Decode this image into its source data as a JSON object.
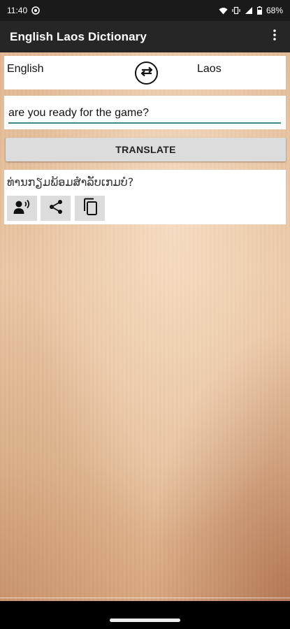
{
  "status_bar": {
    "time": "11:40",
    "battery": "68%"
  },
  "app_bar": {
    "title": "English Laos Dictionary"
  },
  "languages": {
    "source": "English",
    "target": "Laos"
  },
  "input": {
    "value": "are you ready for the game?"
  },
  "translate_button": {
    "label": "TRANSLATE"
  },
  "result": {
    "text": "ທ່ານກຽມພ້ອມສໍາລັບເກມບໍ?"
  },
  "icons": {
    "status": [
      "message-circle-icon",
      "wifi-icon",
      "vibrate-icon",
      "signal-icon",
      "battery-icon"
    ],
    "toolbar": [
      "more-vert-icon"
    ],
    "swap": "swap-icon",
    "actions": [
      "speak-icon",
      "share-icon",
      "copy-icon"
    ]
  }
}
